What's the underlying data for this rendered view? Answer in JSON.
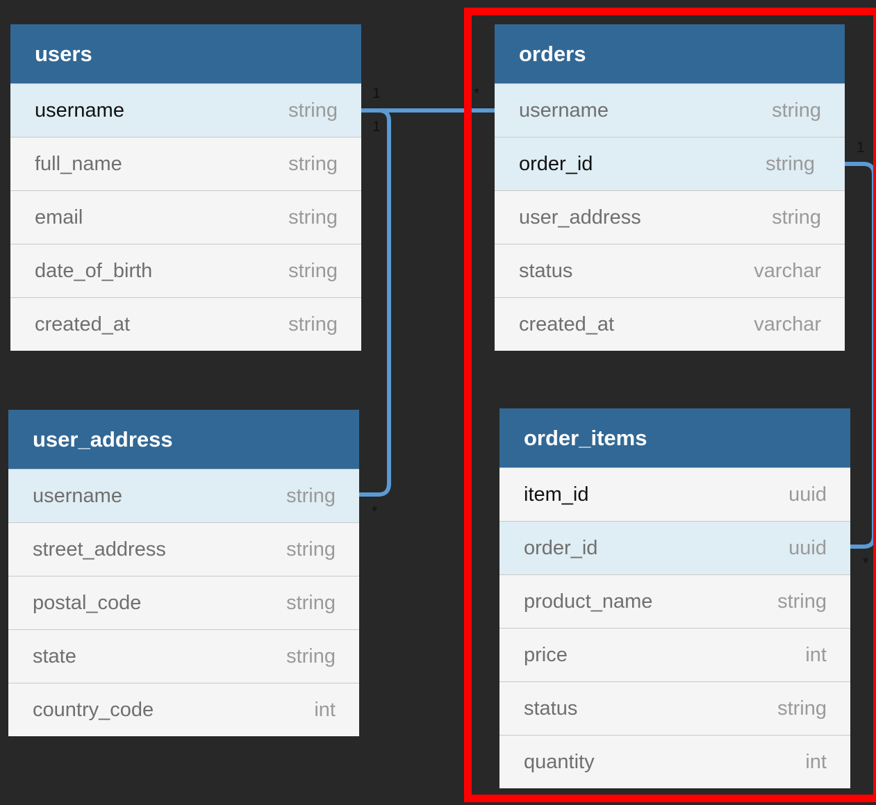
{
  "colors": {
    "background": "#282828",
    "header": "#326895",
    "row": "#f5f5f5",
    "linked_row": "#dfedf4",
    "connector": "#5b9bd5",
    "highlight": "#ff0000"
  },
  "tables": {
    "users": {
      "name": "users",
      "fields": [
        {
          "name": "username",
          "type": "string"
        },
        {
          "name": "full_name",
          "type": "string"
        },
        {
          "name": "email",
          "type": "string"
        },
        {
          "name": "date_of_birth",
          "type": "string"
        },
        {
          "name": "created_at",
          "type": "string"
        }
      ]
    },
    "user_address": {
      "name": "user_address",
      "fields": [
        {
          "name": "username",
          "type": "string"
        },
        {
          "name": "street_address",
          "type": "string"
        },
        {
          "name": "postal_code",
          "type": "string"
        },
        {
          "name": "state",
          "type": "string"
        },
        {
          "name": "country_code",
          "type": "int"
        }
      ]
    },
    "orders": {
      "name": "orders",
      "fields": [
        {
          "name": "username",
          "type": "string"
        },
        {
          "name": "order_id",
          "type": "string"
        },
        {
          "name": "user_address",
          "type": "string"
        },
        {
          "name": "status",
          "type": "varchar"
        },
        {
          "name": "created_at",
          "type": "varchar"
        }
      ]
    },
    "order_items": {
      "name": "order_items",
      "fields": [
        {
          "name": "item_id",
          "type": "uuid"
        },
        {
          "name": "order_id",
          "type": "uuid"
        },
        {
          "name": "product_name",
          "type": "string"
        },
        {
          "name": "price",
          "type": "int"
        },
        {
          "name": "status",
          "type": "string"
        },
        {
          "name": "quantity",
          "type": "int"
        }
      ]
    }
  },
  "relationships": {
    "users_orders": {
      "from_label": "1",
      "to_label": "*"
    },
    "users_user_address": {
      "from_label": "1",
      "to_label": "*"
    },
    "orders_order_items": {
      "from_label": "1",
      "to_label": "*"
    }
  }
}
